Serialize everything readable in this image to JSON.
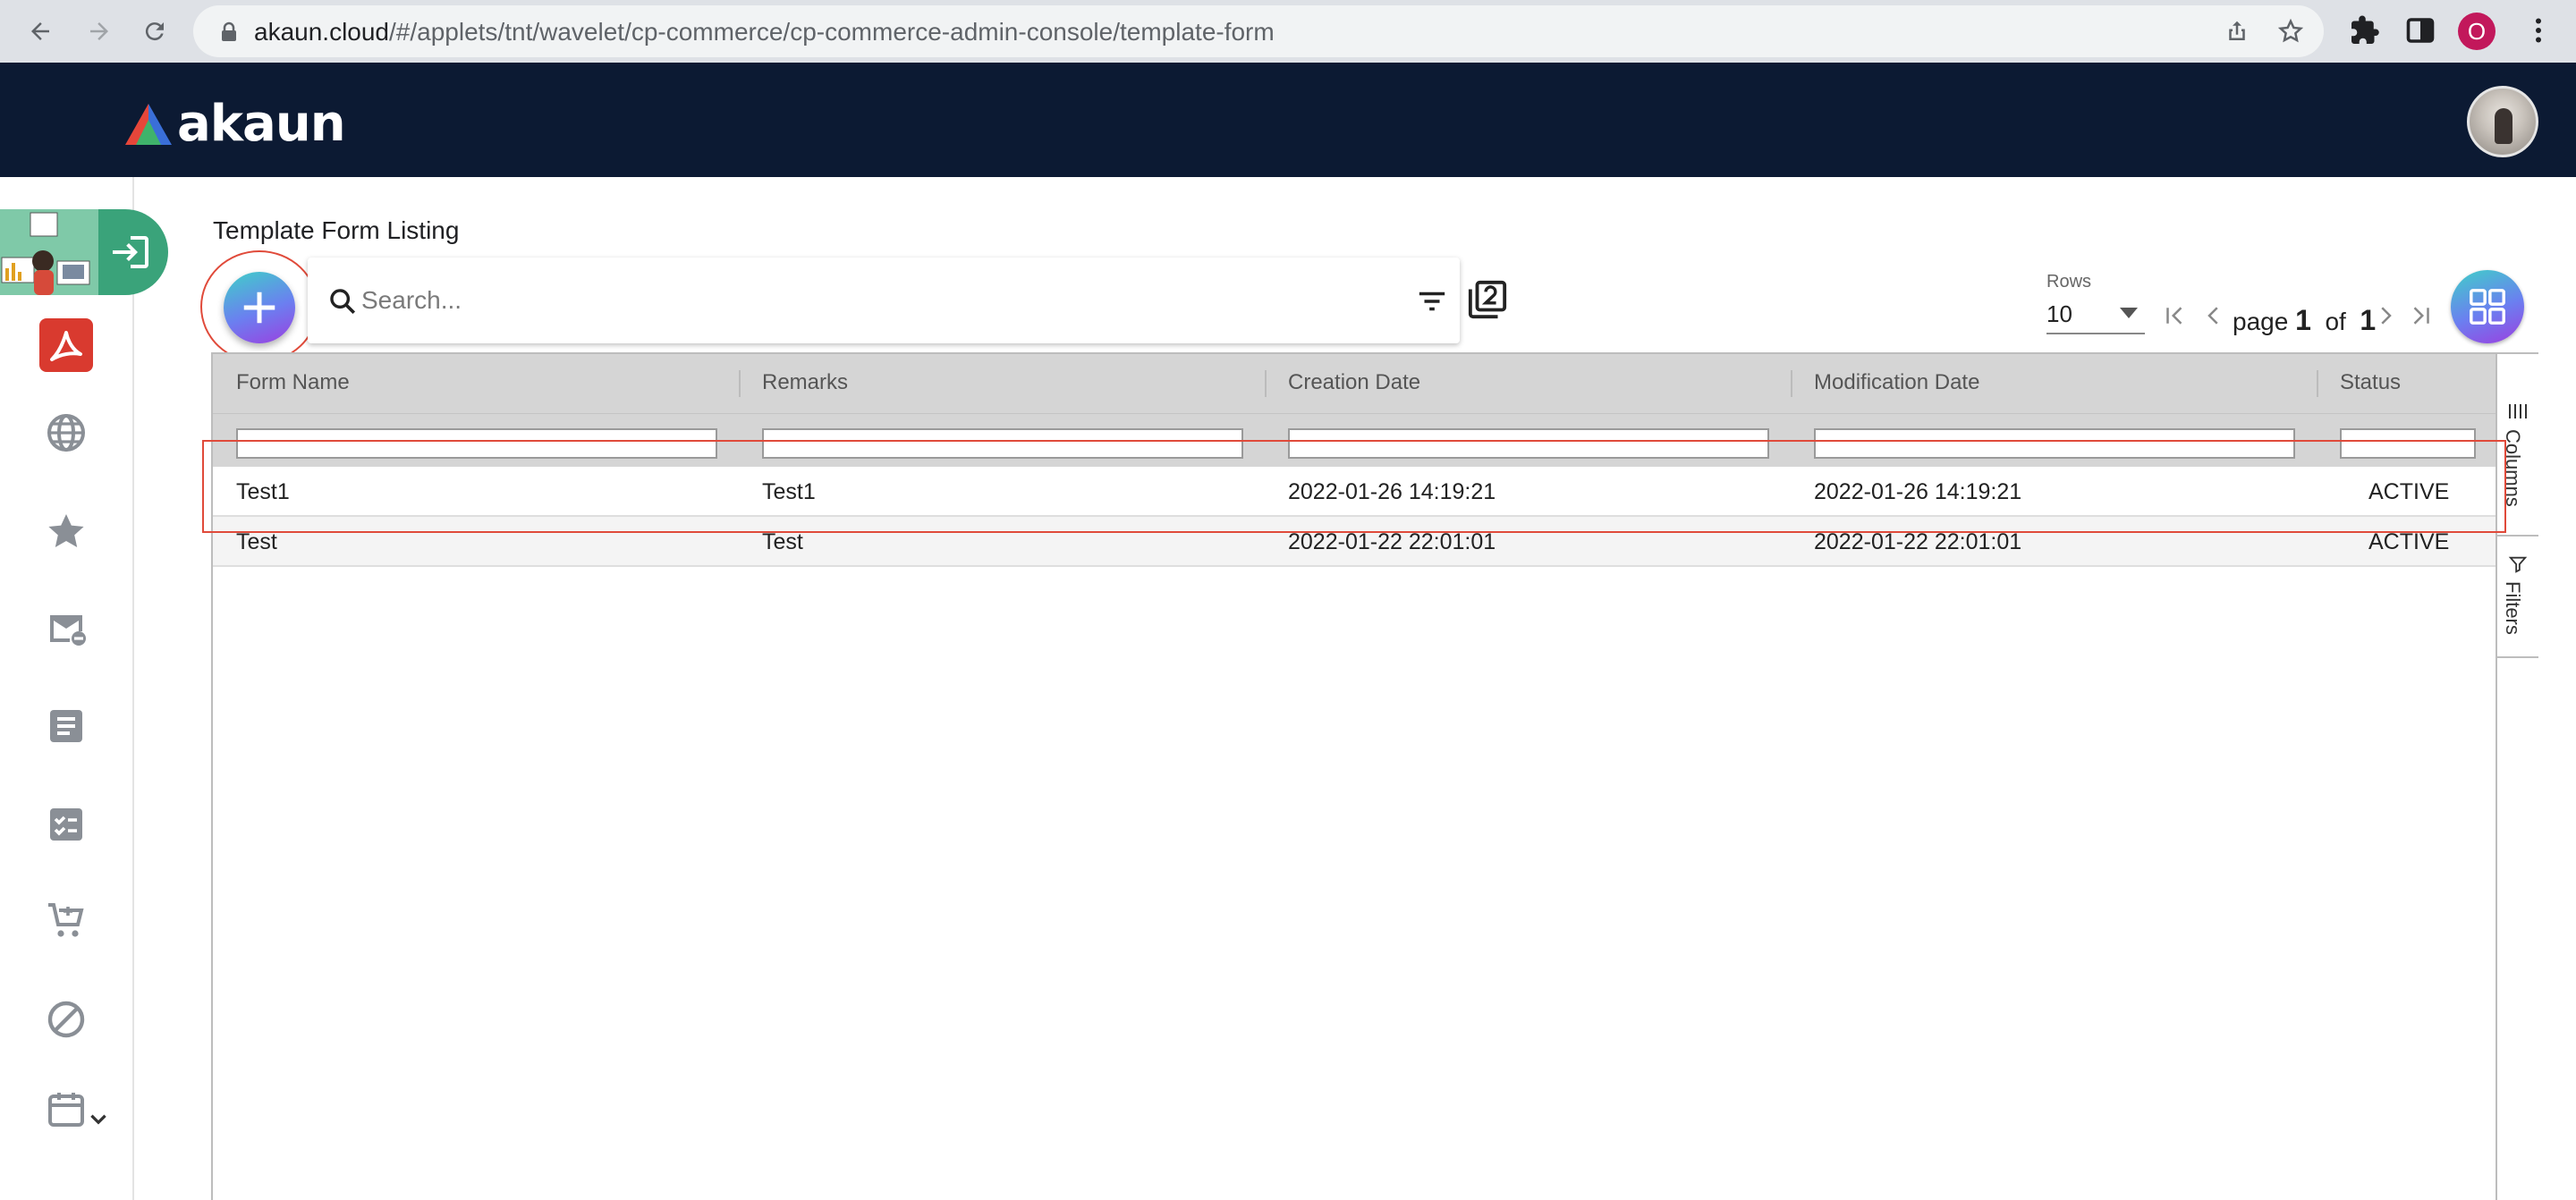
{
  "browser": {
    "url_host": "akaun.cloud",
    "url_path": "/#/applets/tnt/wavelet/cp-commerce/cp-commerce-admin-console/template-form",
    "profile_initial": "O"
  },
  "app": {
    "brand": "akaun",
    "colors": {
      "header": "#0c1a33",
      "accent_red": "#e04a3a",
      "sidebar_tab": "#3aa37a"
    }
  },
  "page": {
    "title": "Template Form Listing",
    "search": {
      "placeholder": "Search...",
      "value": ""
    }
  },
  "pagination": {
    "rows_label": "Rows",
    "rows_value": "10",
    "page_word": "page",
    "current_page": "1",
    "of_word": "of",
    "total_pages": "1"
  },
  "grid": {
    "columns": [
      "Form Name",
      "Remarks",
      "Creation Date",
      "Modification Date",
      "Status"
    ],
    "rows": [
      [
        "Test1",
        "Test1",
        "2022-01-26 14:19:21",
        "2022-01-26 14:19:21",
        "ACTIVE"
      ],
      [
        "Test",
        "Test",
        "2022-01-22 22:01:01",
        "2022-01-22 22:01:01",
        "ACTIVE"
      ]
    ],
    "side_panel": {
      "columns": "Columns",
      "filters": "Filters"
    }
  }
}
